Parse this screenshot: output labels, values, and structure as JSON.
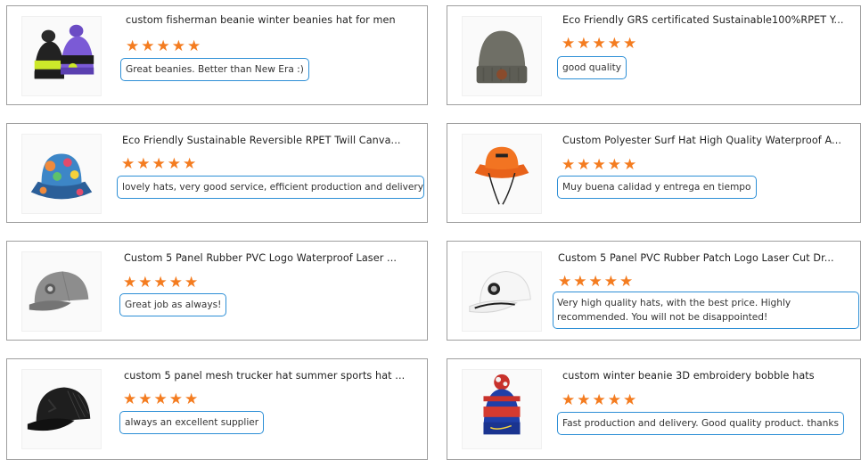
{
  "reviews": [
    {
      "title": "custom fisherman beanie winter beanies hat for men",
      "rating": 5,
      "stars": "★★★★★",
      "text": "Great beanies. Better than New Era :)",
      "thumb": "pom-beanie-pair-icon"
    },
    {
      "title": "Eco Friendly GRS certificated Sustainable100%RPET Y...",
      "rating": 5,
      "stars": "★★★★★",
      "text": "good quality",
      "thumb": "grey-beanie-icon"
    },
    {
      "title": "Eco Friendly Sustainable Reversible RPET Twill Canva...",
      "rating": 5,
      "stars": "★★★★★",
      "text": "lovely hats, very good service, efficient production and delivery",
      "thumb": "floral-bucket-hat-icon"
    },
    {
      "title": "Custom Polyester Surf Hat High Quality Waterproof A...",
      "rating": 5,
      "stars": "★★★★★",
      "text": "Muy buena calidad y entrega en tiempo",
      "thumb": "orange-surf-hat-icon"
    },
    {
      "title": "Custom 5 Panel Rubber PVC Logo Waterproof Laser ...",
      "rating": 5,
      "stars": "★★★★★",
      "text": "Great job as always!",
      "thumb": "grey-cap-icon"
    },
    {
      "title": "Custom 5 Panel PVC Rubber Patch Logo Laser Cut Dr...",
      "rating": 5,
      "stars": "★★★★★",
      "text": "Very high quality hats, with the best price. Highly recommended. You will not be disappointed!",
      "thumb": "white-rope-cap-icon"
    },
    {
      "title": "custom 5 panel mesh trucker hat summer sports hat ...",
      "rating": 5,
      "stars": "★★★★★",
      "text": "always an excellent supplier",
      "thumb": "black-trucker-cap-icon"
    },
    {
      "title": "custom winter beanie 3D embroidery bobble hats",
      "rating": 5,
      "stars": "★★★★★",
      "text": "Fast production and delivery. Good quality product. thanks",
      "thumb": "bobble-beanie-icon"
    }
  ]
}
